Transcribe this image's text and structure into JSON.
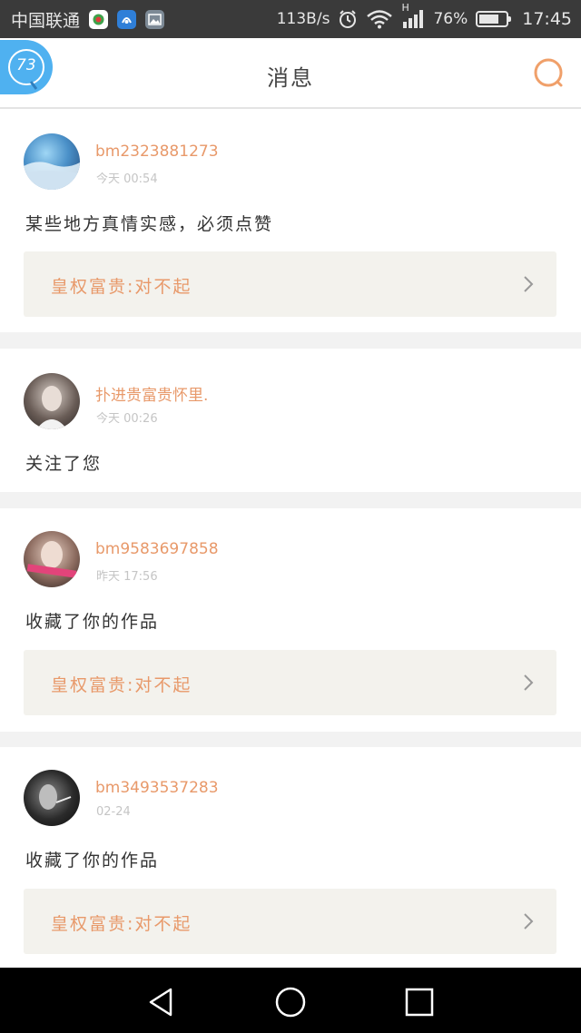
{
  "status_bar": {
    "carrier": "中国联通",
    "net_speed": "113B/s",
    "battery": "76%",
    "battery_level": 0.76,
    "time": "17:45",
    "network_type": "H"
  },
  "header": {
    "title": "消息",
    "float_badge": "73",
    "search_icon": "search-icon",
    "accent_color": "#f0a06a"
  },
  "messages": [
    {
      "username": "bm2323881273",
      "time": "今天 00:54",
      "text": "某些地方真情实感，必须点赞",
      "work_title": "皇权富贵:对不起"
    },
    {
      "username": "扑进贵富贵怀里.",
      "time": "今天 00:26",
      "text": "关注了您"
    },
    {
      "username": "bm9583697858",
      "time": "昨天 17:56",
      "text": "收藏了你的作品",
      "work_title": "皇权富贵:对不起"
    },
    {
      "username": "bm3493537283",
      "time": "02-24",
      "text": "收藏了你的作品",
      "work_title": "皇权富贵:对不起"
    }
  ],
  "nav": {
    "back": "back-icon",
    "home": "home-icon",
    "recents": "recents-icon"
  }
}
